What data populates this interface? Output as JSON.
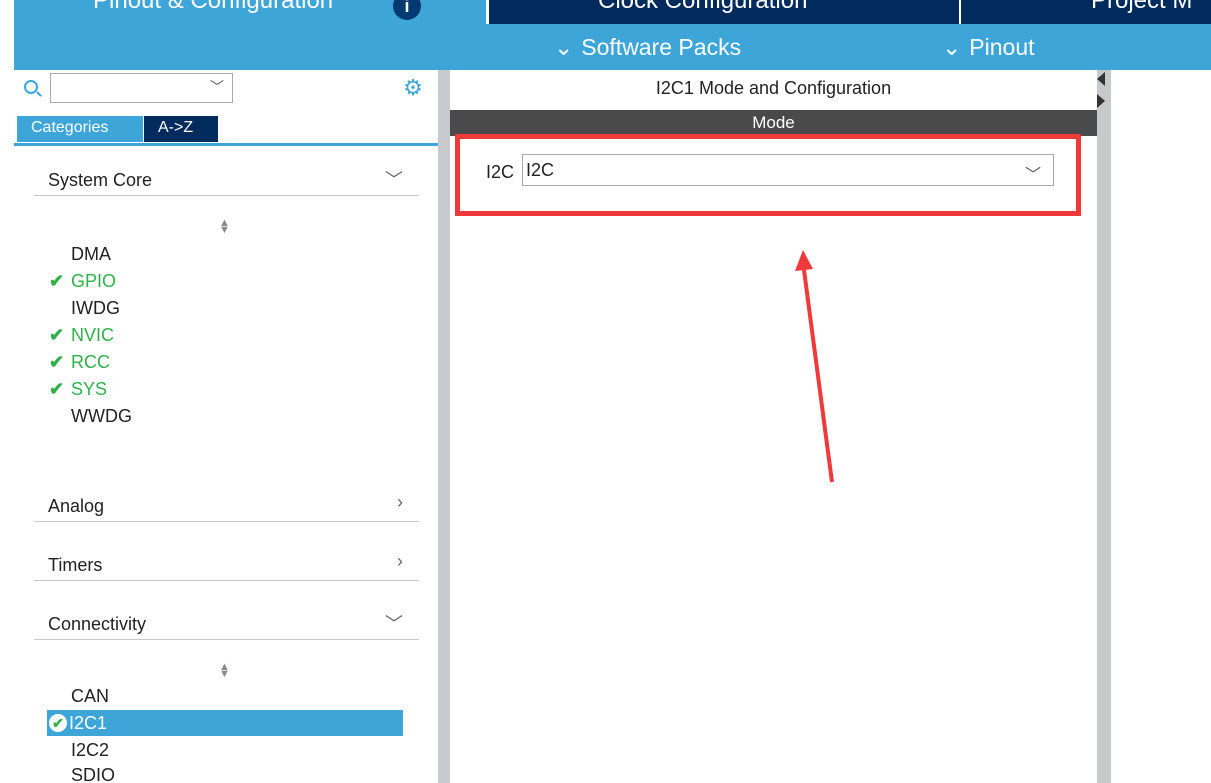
{
  "tabs": [
    {
      "label": "Pinout & Configuration"
    },
    {
      "label": "Clock Configuration"
    },
    {
      "label": "Project M"
    }
  ],
  "toolbar": {
    "software_packs": "Software Packs",
    "pinout": "Pinout",
    "chevron": "❯"
  },
  "sidebar": {
    "search_value": "",
    "category_tabs": [
      "Categories",
      "A->Z"
    ],
    "sections": {
      "system_core": "System Core",
      "analog": "Analog",
      "timers": "Timers",
      "connectivity": "Connectivity"
    },
    "system_core_items": [
      {
        "name": "DMA",
        "enabled": false
      },
      {
        "name": "GPIO",
        "enabled": true
      },
      {
        "name": "IWDG",
        "enabled": false
      },
      {
        "name": "NVIC",
        "enabled": true
      },
      {
        "name": "RCC",
        "enabled": true
      },
      {
        "name": "SYS",
        "enabled": true
      },
      {
        "name": "WWDG",
        "enabled": false
      }
    ],
    "connectivity_items": [
      {
        "name": "CAN",
        "enabled": false
      },
      {
        "name": "I2C1",
        "enabled": true,
        "selected": true
      },
      {
        "name": "I2C2",
        "enabled": false
      },
      {
        "name": "SDIO",
        "enabled": false
      }
    ]
  },
  "center": {
    "title": "I2C1 Mode and Configuration",
    "mode_header": "Mode",
    "i2c_label": "I2C",
    "i2c_value": "I2C"
  },
  "colors": {
    "accent": "#3ea5d9",
    "dark_tab": "#002b5c",
    "enabled": "#2fb04a",
    "annotation": "#ee3a3a"
  }
}
